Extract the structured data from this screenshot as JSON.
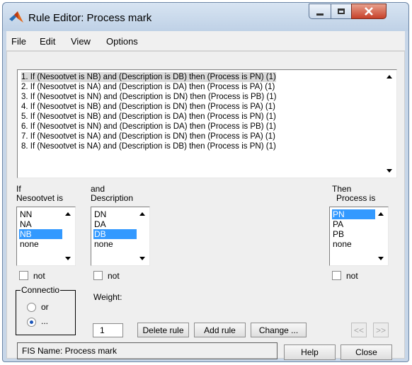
{
  "window": {
    "title": "Rule Editor: Process mark"
  },
  "menu": [
    "File",
    "Edit",
    "View",
    "Options"
  ],
  "rules": [
    "1. If (Nesootvet is NB) and (Description is DB) then (Process is PN) (1)",
    "2. If (Nesootvet is NA) and (Description is DA) then (Process is PA) (1)",
    "3. If (Nesootvet is NN) and (Description is DN) then (Process is PB) (1)",
    "4. If (Nesootvet is NB) and (Description is DN) then (Process is PA) (1)",
    "5. If (Nesootvet is NB) and (Description is DA) then (Process is PN) (1)",
    "6. If (Nesootvet is NN) and (Description is DA) then (Process is PB) (1)",
    "7. If (Nesootvet is NA) and (Description is DN) then (Process is PA) (1)",
    "8. If (Nesootvet is NA) and (Description is DB) then (Process is PN) (1)"
  ],
  "if_panel": {
    "label1": "If",
    "label2": "Nesootvet is",
    "options": [
      "NN",
      "NA",
      "NB",
      "none"
    ],
    "selected": "NB",
    "not_label": "not"
  },
  "and_panel": {
    "label1": "and",
    "label2": "Description",
    "options": [
      "DN",
      "DA",
      "DB",
      "none"
    ],
    "selected": "DB",
    "not_label": "not"
  },
  "then_panel": {
    "label1": "Then",
    "label2": "Process is",
    "options": [
      "PN",
      "PA",
      "PB",
      "none"
    ],
    "selected": "PN",
    "not_label": "not"
  },
  "connection": {
    "legend": "Connectio",
    "or_label": "or",
    "and_label": "...",
    "selected": "..."
  },
  "weight": {
    "label": "Weight:",
    "value": "1"
  },
  "buttons": {
    "delete_rule": "Delete rule",
    "add_rule": "Add rule",
    "change": "Change ...",
    "prev": "<<",
    "next": ">>",
    "help": "Help",
    "close": "Close"
  },
  "status": "FIS Name: Process mark",
  "colors": {
    "selection": "#3399ff",
    "rule_selection": "#d9d9d9"
  }
}
